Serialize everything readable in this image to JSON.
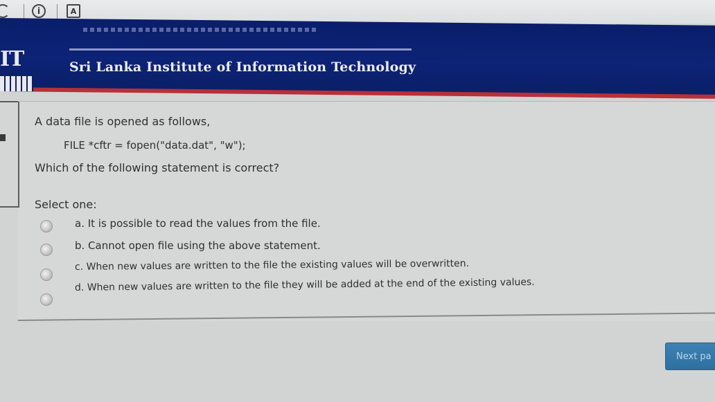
{
  "browser": {
    "reader_icon_label": "A"
  },
  "header": {
    "logo_text": "IT",
    "institute_name": "Sri Lanka Institute of Information Technology"
  },
  "question": {
    "prompt_line1": "A data file is opened as follows,",
    "code": "FILE *cftr = fopen(\"data.dat\", \"w\");",
    "prompt_line3": "Which of the following statement is correct?",
    "select_label": "Select one:",
    "options": [
      {
        "label": "a. It is possible to read the values from the file.",
        "selected": false
      },
      {
        "label": "b. Cannot open file using the above statement.",
        "selected": false
      },
      {
        "label": "c. When new values are written to the file the existing values will be overwritten.",
        "selected": false
      },
      {
        "label": "d. When new values are written to the file they will be added at the end of the existing values.",
        "selected": false
      }
    ]
  },
  "navigation": {
    "next_label": "Next pa"
  },
  "colors": {
    "header_blue": "#0c2376",
    "header_red": "#b8303a",
    "button_blue": "#3d82b5"
  }
}
